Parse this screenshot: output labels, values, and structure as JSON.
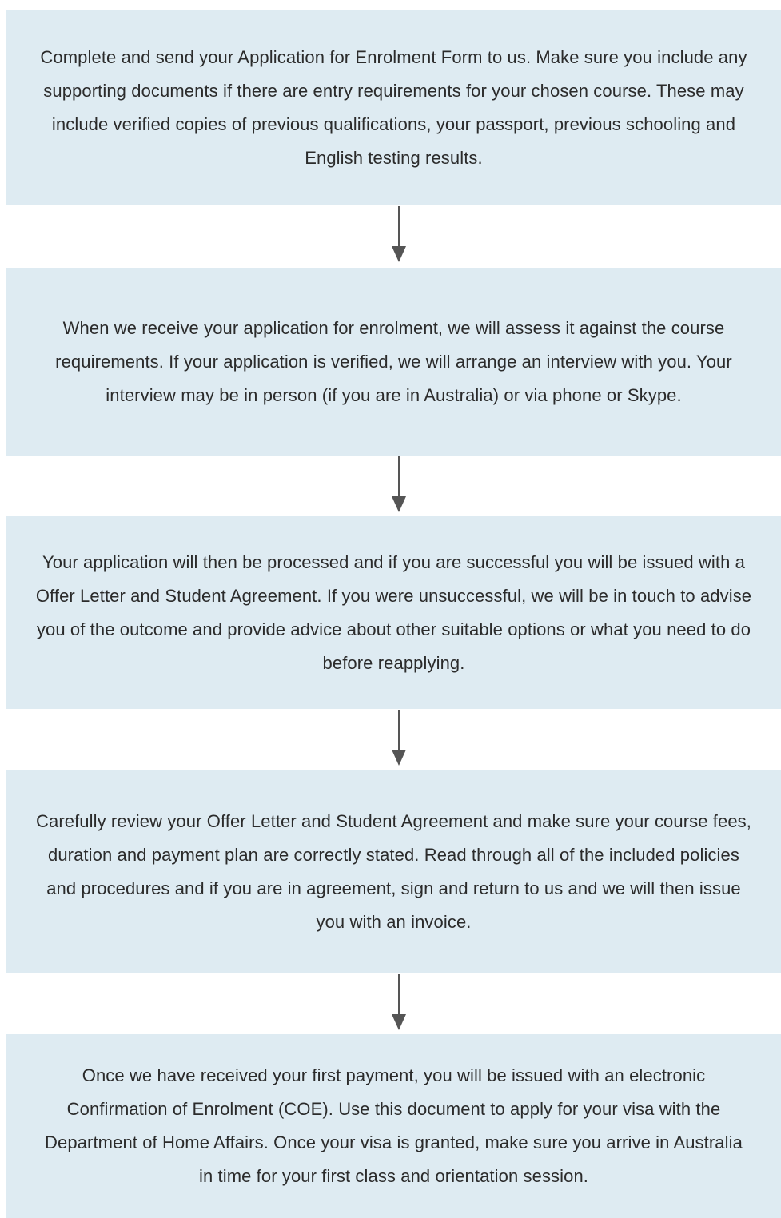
{
  "flowchart": {
    "steps": [
      {
        "text": "Complete and send your Application for Enrolment Form to us. Make sure you include any supporting documents if there are entry requirements for your chosen course. These may include verified copies of previous qualifications, your passport, previous schooling and English testing results."
      },
      {
        "text": "When we receive your application for enrolment, we will assess it against the course requirements. If your application is verified, we will arrange an interview with you. Your interview may be in person (if you are in Australia) or via phone or Skype."
      },
      {
        "text": "Your application will then be processed and if you are successful you will be issued with a Offer Letter and Student Agreement. If you were unsuccessful, we will be in touch to advise you of the outcome and provide advice about other suitable options or what you need to do before reapplying."
      },
      {
        "text": "Carefully review your Offer Letter and Student Agreement and make sure your course fees, duration and payment plan are correctly stated. Read through all of the included policies and procedures and if you are in agreement, sign and return to us and we will then issue you with an invoice."
      },
      {
        "text": "Once we have received your first payment, you will be issued with an electronic Confirmation of Enrolment (COE). Use this document to apply for your visa with the Department of Home Affairs. Once your visa is granted, make sure you arrive in Australia in time for your first class and orientation session."
      }
    ],
    "colors": {
      "box_fill": "#deebf2",
      "text": "#2b2b2b",
      "arrow": "#555555"
    }
  }
}
